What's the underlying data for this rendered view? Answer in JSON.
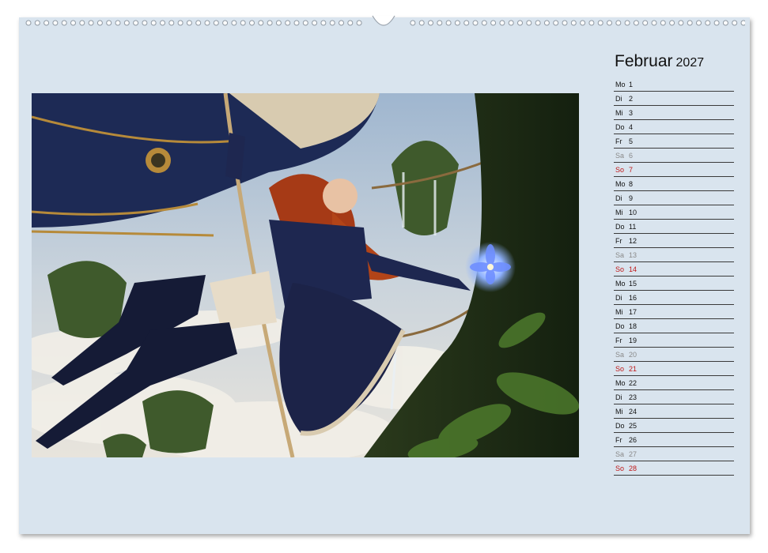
{
  "calendar": {
    "month": "Februar",
    "year": "2027",
    "days": [
      {
        "name": "Mo",
        "day": "1",
        "type": "weekday"
      },
      {
        "name": "Di",
        "day": "2",
        "type": "weekday"
      },
      {
        "name": "Mi",
        "day": "3",
        "type": "weekday"
      },
      {
        "name": "Do",
        "day": "4",
        "type": "weekday"
      },
      {
        "name": "Fr",
        "day": "5",
        "type": "weekday"
      },
      {
        "name": "Sa",
        "day": "6",
        "type": "saturday"
      },
      {
        "name": "So",
        "day": "7",
        "type": "sunday"
      },
      {
        "name": "Mo",
        "day": "8",
        "type": "weekday"
      },
      {
        "name": "Di",
        "day": "9",
        "type": "weekday"
      },
      {
        "name": "Mi",
        "day": "10",
        "type": "weekday"
      },
      {
        "name": "Do",
        "day": "11",
        "type": "weekday"
      },
      {
        "name": "Fr",
        "day": "12",
        "type": "weekday"
      },
      {
        "name": "Sa",
        "day": "13",
        "type": "saturday"
      },
      {
        "name": "So",
        "day": "14",
        "type": "sunday"
      },
      {
        "name": "Mo",
        "day": "15",
        "type": "weekday"
      },
      {
        "name": "Di",
        "day": "16",
        "type": "weekday"
      },
      {
        "name": "Mi",
        "day": "17",
        "type": "weekday"
      },
      {
        "name": "Do",
        "day": "18",
        "type": "weekday"
      },
      {
        "name": "Fr",
        "day": "19",
        "type": "weekday"
      },
      {
        "name": "Sa",
        "day": "20",
        "type": "saturday"
      },
      {
        "name": "So",
        "day": "21",
        "type": "sunday"
      },
      {
        "name": "Mo",
        "day": "22",
        "type": "weekday"
      },
      {
        "name": "Di",
        "day": "23",
        "type": "weekday"
      },
      {
        "name": "Mi",
        "day": "24",
        "type": "weekday"
      },
      {
        "name": "Do",
        "day": "25",
        "type": "weekday"
      },
      {
        "name": "Fr",
        "day": "26",
        "type": "weekday"
      },
      {
        "name": "Sa",
        "day": "27",
        "type": "saturday"
      },
      {
        "name": "So",
        "day": "28",
        "type": "sunday"
      }
    ]
  },
  "colors": {
    "sheet_background": "#d9e4ee",
    "sunday": "#c01818",
    "saturday": "#8a8a8a",
    "weekday": "#111111"
  },
  "image": {
    "subject": "steampunk-fantasy-illustration",
    "icon": "photo-illustration"
  }
}
